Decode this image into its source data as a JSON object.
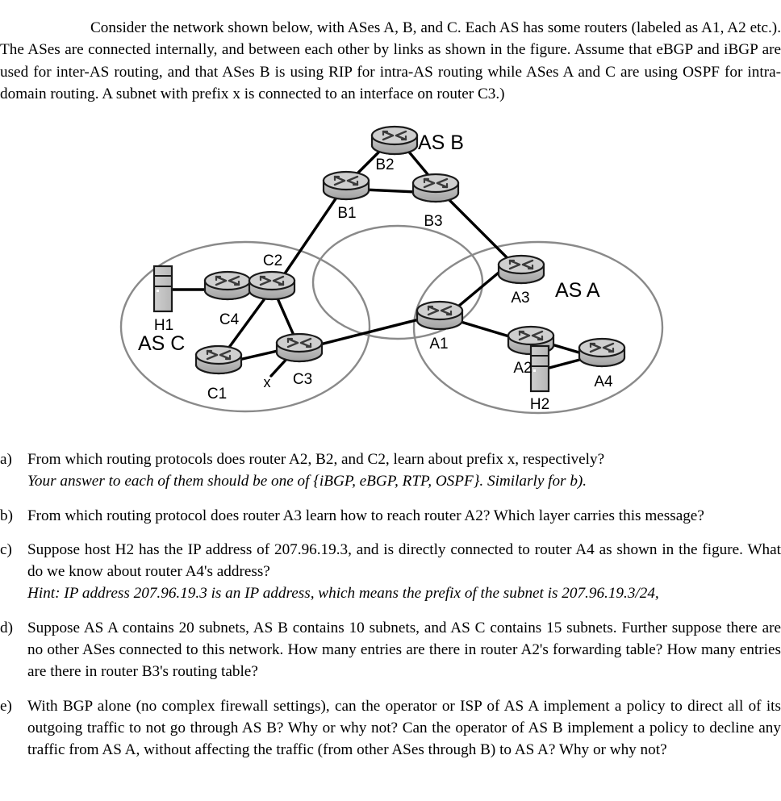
{
  "document": {
    "intro": "Consider the network shown below, with ASes A, B, and C. Each AS has some routers (labeled as A1, A2 etc.). The ASes are connected internally, and between each other by links as shown in the figure. Assume that eBGP and iBGP are used for inter-AS routing, and that ASes B is using RIP for intra-AS routing while ASes A and C are using OSPF for intra-domain routing. A subnet with prefix x is connected to an interface on router C3.)"
  },
  "figure": {
    "as_labels": [
      {
        "id": "as-b",
        "text": "AS B"
      },
      {
        "id": "as-c",
        "text": "AS C"
      },
      {
        "id": "as-a",
        "text": "AS A"
      }
    ],
    "nodes": [
      {
        "id": "B1",
        "label": "B1",
        "type": "router",
        "as": "B"
      },
      {
        "id": "B2",
        "label": "B2",
        "type": "router",
        "as": "B"
      },
      {
        "id": "B3",
        "label": "B3",
        "type": "router",
        "as": "B"
      },
      {
        "id": "C1",
        "label": "C1",
        "type": "router",
        "as": "C"
      },
      {
        "id": "C2",
        "label": "C2",
        "type": "router",
        "as": "C"
      },
      {
        "id": "C3",
        "label": "C3",
        "type": "router",
        "as": "C"
      },
      {
        "id": "C4",
        "label": "C4",
        "type": "router",
        "as": "C"
      },
      {
        "id": "H1",
        "label": "H1",
        "type": "host",
        "as": "C"
      },
      {
        "id": "A1",
        "label": "A1",
        "type": "router",
        "as": "A"
      },
      {
        "id": "A2",
        "label": "A2",
        "type": "router",
        "as": "A"
      },
      {
        "id": "A3",
        "label": "A3",
        "type": "router",
        "as": "A"
      },
      {
        "id": "A4",
        "label": "A4",
        "type": "router",
        "as": "A"
      },
      {
        "id": "H2",
        "label": "H2",
        "type": "host",
        "as": "A"
      }
    ],
    "prefix_stub_label": "x",
    "links": [
      {
        "from": "B1",
        "to": "B2",
        "kind": "intra"
      },
      {
        "from": "B2",
        "to": "B3",
        "kind": "intra"
      },
      {
        "from": "B1",
        "to": "B3",
        "kind": "intra"
      },
      {
        "from": "B1",
        "to": "C2",
        "kind": "inter"
      },
      {
        "from": "B3",
        "to": "A3",
        "kind": "inter"
      },
      {
        "from": "C3",
        "to": "A1",
        "kind": "inter"
      },
      {
        "from": "H1",
        "to": "C4",
        "kind": "access"
      },
      {
        "from": "C4",
        "to": "C2",
        "kind": "intra"
      },
      {
        "from": "C2",
        "to": "C1",
        "kind": "intra"
      },
      {
        "from": "C2",
        "to": "C3",
        "kind": "intra"
      },
      {
        "from": "C1",
        "to": "C3",
        "kind": "intra"
      },
      {
        "from": "A1",
        "to": "A3",
        "kind": "intra"
      },
      {
        "from": "A1",
        "to": "A2",
        "kind": "intra"
      },
      {
        "from": "A2",
        "to": "A4",
        "kind": "intra"
      },
      {
        "from": "H2",
        "to": "A4",
        "kind": "access"
      }
    ],
    "colors": {
      "router_body": "#b0b0b0",
      "router_top": "#cccccc",
      "router_outline": "#1a1a1a",
      "host_fill": "#c0c0c0",
      "ellipse_stroke": "#8a8a8a",
      "link_stroke": "#000000"
    }
  },
  "questions": [
    {
      "marker": "a)",
      "text": "From which routing protocols does router A2, B2, and C2, learn about prefix x, respectively?",
      "hint": "Your answer to each of them should be one of {iBGP, eBGP, RTP, OSPF}. Similarly for b)."
    },
    {
      "marker": "b)",
      "text": "From which routing protocol does router A3 learn how to reach router A2? Which layer carries this message?",
      "hint": ""
    },
    {
      "marker": "c)",
      "text": "Suppose host H2 has the IP address of 207.96.19.3, and is directly connected to router A4 as shown in the figure. What do we know about router A4's address?",
      "hint": "Hint: IP address 207.96.19.3 is an IP address, which means the prefix of the subnet is 207.96.19.3/24,"
    },
    {
      "marker": "d)",
      "text": "Suppose AS A contains 20 subnets, AS B contains 10 subnets, and AS C contains 15 subnets. Further suppose there are no other ASes connected to this network. How many entries are there in router A2's forwarding table? How many entries are there in router B3's routing table?",
      "hint": ""
    },
    {
      "marker": "e)",
      "text": "With BGP alone (no complex firewall settings), can the operator or ISP of AS A implement a policy to direct all of its outgoing traffic to not go through AS B? Why or why not? Can the operator of AS B implement a policy to decline any traffic from AS A, without affecting the traffic (from other ASes through B) to AS A? Why or why not?",
      "hint": ""
    }
  ]
}
